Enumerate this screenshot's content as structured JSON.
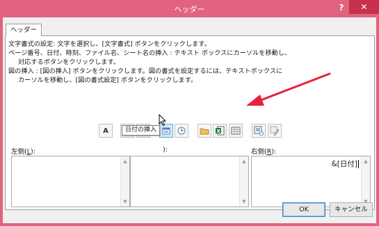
{
  "window": {
    "title": "ヘッダー",
    "help_label": "?",
    "close_label": "✕"
  },
  "tab": {
    "label": "ヘッダー"
  },
  "instructions": [
    "文字書式の設定: 文字を選択し、[文字書式] ボタンをクリックします。",
    "ページ番号、日付、時刻、ファイル名、シート名の挿入 : テキスト ボックスにカーソルを移動し、",
    "対応するボタンをクリックします。",
    "図の挿入 : [図の挿入] ボタンをクリックします。図の書式を設定するには、テキストボックスに",
    "カーソルを移動し、[図の書式設定] ボタンをクリックします。"
  ],
  "toolbar": {
    "buttons": [
      {
        "name": "format-text",
        "icon": "letter-a-icon",
        "glyph": "A"
      },
      {
        "name": "insert-page-number",
        "icon": "page-number-icon"
      },
      {
        "name": "insert-number-of-pages",
        "icon": "number-of-pages-icon"
      },
      {
        "name": "insert-date",
        "icon": "calendar-icon"
      },
      {
        "name": "insert-time",
        "icon": "clock-icon"
      },
      {
        "name": "insert-file-path",
        "icon": "folder-icon"
      },
      {
        "name": "insert-file-name",
        "icon": "excel-file-icon"
      },
      {
        "name": "insert-sheet-name",
        "icon": "sheet-tab-icon"
      },
      {
        "name": "insert-picture",
        "icon": "picture-icon"
      },
      {
        "name": "format-picture",
        "icon": "format-picture-icon"
      }
    ],
    "tooltip": "日付の挿入"
  },
  "sections": {
    "left": {
      "label_pre": "左側(",
      "label_key": "L",
      "label_post": "):",
      "text": ""
    },
    "center": {
      "label_tail": "):",
      "text": ""
    },
    "right": {
      "label_pre": "右側(",
      "label_key": "R",
      "label_post": "):",
      "text": "&[日付]"
    }
  },
  "buttons": {
    "ok": "OK",
    "cancel": "キャンセル"
  },
  "colors": {
    "frame": "#e2637f",
    "close": "#c7314c",
    "arrow": "#e8213b"
  }
}
